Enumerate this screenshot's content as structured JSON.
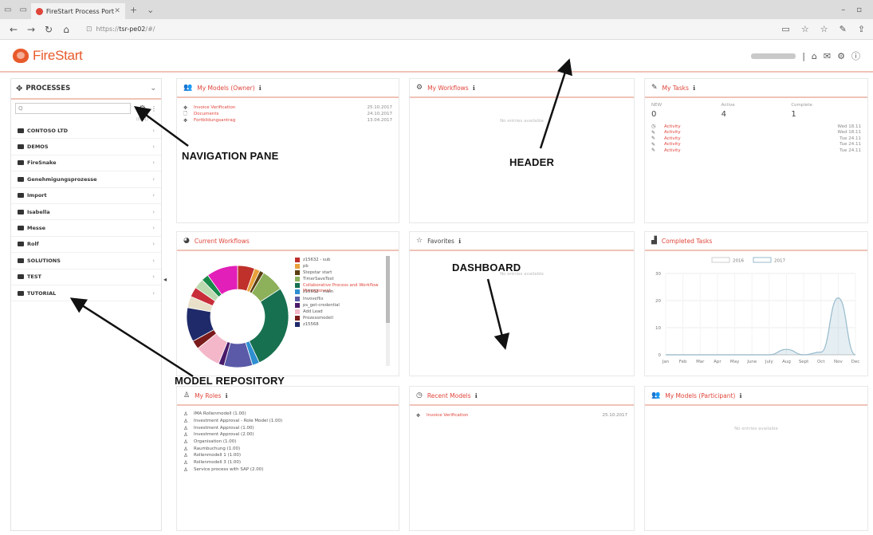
{
  "browser": {
    "tab_title": "FireStart Process Portal",
    "url_prefix": "https://",
    "url_host": "tsr-pe02",
    "url_rest": "/#/"
  },
  "header": {
    "logo_text": "FireStart"
  },
  "nav_pane": {
    "title": "PROCESSES",
    "search_placeholder": "Q",
    "count": "(0/11)",
    "folders": [
      {
        "label": "CONTOSO LTD"
      },
      {
        "label": "DEMOS"
      },
      {
        "label": "FireSnake"
      },
      {
        "label": "Genehmigungsprozesse"
      },
      {
        "label": "Import"
      },
      {
        "label": "Isabella"
      },
      {
        "label": "Messe"
      },
      {
        "label": "Rolf"
      },
      {
        "label": "SOLUTIONS"
      },
      {
        "label": "TEST"
      },
      {
        "label": "TUTORIAL"
      }
    ]
  },
  "panels": {
    "my_models_owner": {
      "title": "My Models (Owner)",
      "rows": [
        {
          "name": "Invoice Verification",
          "date": "25.10.2017"
        },
        {
          "name": "Documents",
          "date": "24.10.2017"
        },
        {
          "name": "Fortbildungsantrag",
          "date": "13.04.2017"
        }
      ]
    },
    "my_workflows": {
      "title": "My Workflows",
      "empty": "No entries available"
    },
    "my_tasks": {
      "title": "My Tasks",
      "stats": [
        {
          "label": "NEW",
          "value": "0"
        },
        {
          "label": "Active",
          "value": "4"
        },
        {
          "label": "Complete",
          "value": "1"
        }
      ],
      "rows": [
        {
          "name": "Activity",
          "date": "Wed 18.11"
        },
        {
          "name": "Activity",
          "date": "Wed 18.11"
        },
        {
          "name": "Activity",
          "date": "Tue 24.11"
        },
        {
          "name": "Activity",
          "date": "Tue 24.11"
        },
        {
          "name": "Activity",
          "date": "Tue 24.11"
        }
      ]
    },
    "current_workflows": {
      "title": "Current Workflows"
    },
    "favorites": {
      "title": "Favorites",
      "empty": "No entries available"
    },
    "completed_tasks": {
      "title": "Completed Tasks"
    },
    "my_roles": {
      "title": "My Roles",
      "rows": [
        {
          "name": "IMA Rollenmodell (1.00)"
        },
        {
          "name": "Investment Approval - Role Model (1.00)"
        },
        {
          "name": "Investment Approval (1.00)"
        },
        {
          "name": "Investment Approval (2.00)"
        },
        {
          "name": "Organisation (1.00)"
        },
        {
          "name": "Raumbuchung (1.00)"
        },
        {
          "name": "Rollenmodell 1 (1.00)"
        },
        {
          "name": "Rollenmodell 3 (1.00)"
        },
        {
          "name": "Service process with SAP (2.00)"
        }
      ]
    },
    "recent_models": {
      "title": "Recent Models",
      "rows": [
        {
          "name": "Invoice Verification",
          "date": "25.10.2017"
        }
      ]
    },
    "my_models_participant": {
      "title": "My Models (Participant)",
      "empty": "No entries available"
    }
  },
  "chart_data": [
    {
      "type": "pie",
      "labels": [
        "z15632 - sub",
        "pb",
        "Stepstar start",
        "TimerSaveTest",
        "Collaborative Process and Workflow Management",
        "z15632 - main",
        "Invoveflix",
        "ps_get-credential",
        "Add Lead",
        "Prozessmodell",
        "z15568"
      ],
      "values": [
        6,
        2,
        1.5,
        8,
        30,
        2.5,
        10,
        2,
        9,
        3,
        12,
        4,
        3.5,
        3.5,
        2.5,
        11
      ],
      "colors": [
        "#c0312b",
        "#e9a23b",
        "#5a3e10",
        "#8db05a",
        "#17704f",
        "#2f8fd1",
        "#5a5aa8",
        "#4a1a6a",
        "#f3b7c9",
        "#7a1a1a",
        "#1f2a6a",
        "#e8e0c8",
        "#c82e3a",
        "#bcd9b0",
        "#1a8a4a",
        "#e21fb8"
      ]
    },
    {
      "type": "area",
      "categories": [
        "Jan",
        "Feb",
        "Mar",
        "Apr",
        "May",
        "June",
        "July",
        "Aug",
        "Sept",
        "Oct",
        "Nov",
        "Dec"
      ],
      "series": [
        {
          "name": "2016",
          "values": [
            0,
            0,
            0,
            0,
            0,
            0,
            0,
            0,
            0,
            0,
            0,
            0
          ]
        },
        {
          "name": "2017",
          "values": [
            0,
            0,
            0,
            0,
            0,
            0,
            0,
            2,
            0,
            1,
            21,
            0
          ]
        }
      ],
      "yticks": [
        "0",
        "10",
        "20",
        "30"
      ],
      "ylim": [
        0,
        30
      ],
      "legend": "top"
    }
  ],
  "annotations": {
    "navigation_pane": "NAVIGATION PANE",
    "header": "HEADER",
    "dashboard": "DASHBOARD",
    "model_repository": "MODEL REPOSITORY"
  }
}
